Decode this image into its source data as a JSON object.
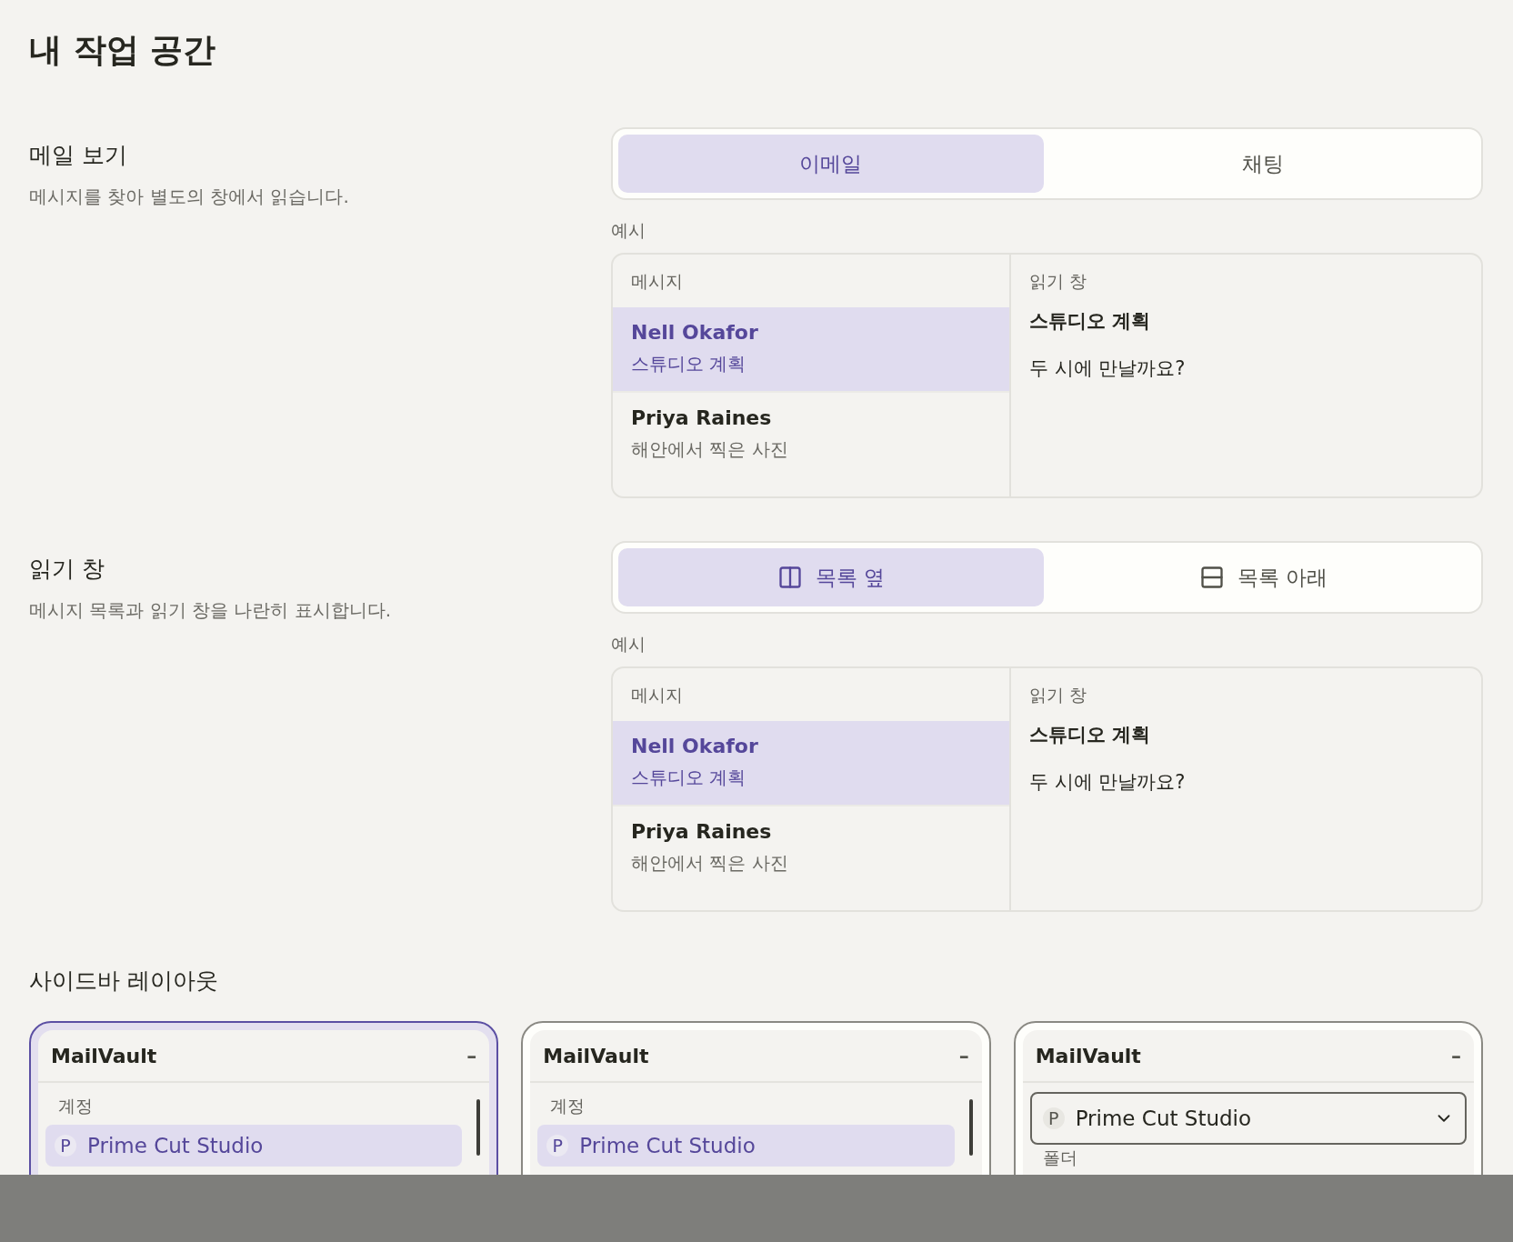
{
  "title": "내 작업 공간",
  "settings": [
    {
      "label": "메일 보기",
      "description": "메시지를 찾아 별도의 창에서 읽습니다.",
      "preview_label": "예시",
      "options": [
        {
          "label": "이메일",
          "selected": true
        },
        {
          "label": "채팅",
          "selected": false
        }
      ],
      "preview": {
        "list_header": "메시지",
        "pane_header": "읽기 창",
        "pane_subject": "스튜디오 계획",
        "pane_body": "두 시에 만날까요?",
        "messages": [
          {
            "sender": "Nell Okafor",
            "subject": "스튜디오 계획",
            "selected": true
          },
          {
            "sender": "Priya Raines",
            "subject": "해안에서 찍은 사진",
            "selected": false
          }
        ]
      }
    },
    {
      "label": "읽기 창",
      "description": "메시지 목록과 읽기 창을 나란히 표시합니다.",
      "preview_label": "예시",
      "options": [
        {
          "label": "목록 옆",
          "selected": true,
          "kind": "columns"
        },
        {
          "label": "목록 아래",
          "selected": false,
          "kind": "rows"
        }
      ],
      "preview": {
        "list_header": "메시지",
        "pane_header": "읽기 창",
        "pane_subject": "스튜디오 계획",
        "pane_body": "두 시에 만날까요?",
        "messages": [
          {
            "sender": "Nell Okafor",
            "subject": "스튜디오 계획",
            "selected": true
          },
          {
            "sender": "Priya Raines",
            "subject": "해안에서 찍은 사진",
            "selected": false
          }
        ]
      }
    }
  ],
  "sidebar_layout": {
    "heading": "사이드바 레이아웃",
    "options": [
      {
        "kind": "list",
        "selected": true,
        "app": "MailVault",
        "collapse": "–",
        "section": "계정",
        "account_initial": "P",
        "account": "Prime Cut Studio"
      },
      {
        "kind": "list",
        "selected": false,
        "app": "MailVault",
        "collapse": "–",
        "section": "계정",
        "account_initial": "P",
        "account": "Prime Cut Studio"
      },
      {
        "kind": "dropdown",
        "selected": false,
        "app": "MailVault",
        "collapse": "–",
        "section": "폴더",
        "account_initial": "P",
        "account": "Prime Cut Studio"
      }
    ]
  }
}
